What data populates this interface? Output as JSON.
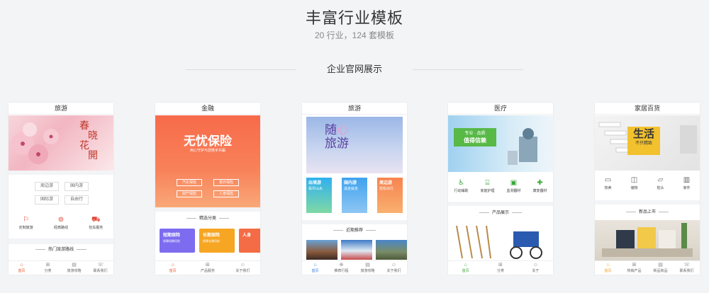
{
  "header": {
    "title": "丰富行业模板",
    "subtitle": "20 行业，124 套模板",
    "section_label": "企业官网展示"
  },
  "colors": {
    "accent": "#e8582a",
    "active_tab": "#e8582a"
  },
  "phones": [
    {
      "title": "旅游",
      "banner_text": [
        "春",
        "花",
        "開",
        "晓"
      ],
      "chips": [
        "周边游",
        "国内游",
        "国际游",
        "自由行"
      ],
      "icons": [
        {
          "icon": "map-pin-icon",
          "label": "定制旅游"
        },
        {
          "icon": "route-icon",
          "label": "经典路线"
        },
        {
          "icon": "car-icon",
          "label": "包车服务"
        }
      ],
      "section": "热门旅游路线",
      "tabs": [
        "首页",
        "分类",
        "旅游攻略",
        "联系我们"
      ]
    },
    {
      "title": "金融",
      "banner_title": "无忧保险",
      "banner_sub": "用心守护与您携手共赢",
      "banner_buttons": [
        "汽车保险",
        "意外保险",
        "财产保险",
        "人身保险"
      ],
      "section": "精选分类",
      "cards": [
        {
          "title": "短期保险",
          "sub": "保障短期风险"
        },
        {
          "title": "长期保险",
          "sub": "保障长期风险"
        },
        {
          "title": "人身",
          "sub": ""
        }
      ],
      "tabs": [
        "首页",
        "产品服务",
        "关于我们"
      ]
    },
    {
      "title": "旅游",
      "banner_text": [
        "随",
        "心",
        "旅",
        "游"
      ],
      "tiles": [
        {
          "title": "出境游",
          "sub": "看尽山水"
        },
        {
          "title": "国内游",
          "sub": "说走就走"
        },
        {
          "title": "周边游",
          "sub": "轻松出行"
        }
      ],
      "section": "近期推荐",
      "tabs": [
        "首页",
        "推荐行程",
        "旅游攻略",
        "关于我们"
      ]
    },
    {
      "title": "医疗",
      "banner_line1": "专业 · 品质",
      "banner_line2": "值得信赖",
      "icons": [
        {
          "icon": "wheelchair-icon",
          "label": "行动辅助"
        },
        {
          "icon": "bed-icon",
          "label": "家庭护理"
        },
        {
          "icon": "monitor-icon",
          "label": "监测器材"
        },
        {
          "icon": "rehab-icon",
          "label": "康复器材"
        }
      ],
      "section": "产品展示",
      "tabs": [
        "首页",
        "分类",
        "关于"
      ]
    },
    {
      "title": "家居百货",
      "banner_line1": "生活",
      "banner_line2": "不只精致",
      "icons": [
        {
          "icon": "sofa-icon",
          "label": "热卖"
        },
        {
          "icon": "storage-icon",
          "label": "储物"
        },
        {
          "icon": "pillow-icon",
          "label": "枕头"
        },
        {
          "icon": "furniture-icon",
          "label": "家件"
        }
      ],
      "section": "新品上市",
      "tabs": [
        "首页",
        "热销产品",
        "新品商品",
        "联系我们"
      ]
    }
  ]
}
